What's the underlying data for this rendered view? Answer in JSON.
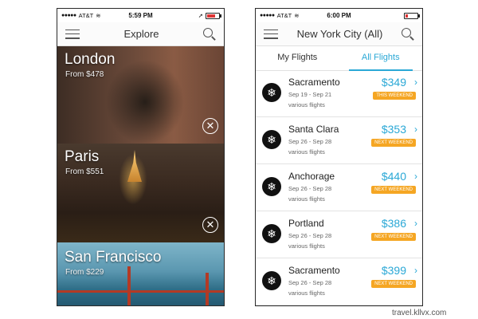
{
  "left_phone": {
    "status": {
      "carrier": "AT&T",
      "time": "5:59 PM"
    },
    "nav": {
      "title": "Explore"
    },
    "destinations": [
      {
        "name": "London",
        "price": "From $478"
      },
      {
        "name": "Paris",
        "price": "From $551"
      },
      {
        "name": "San Francisco",
        "price": "From $229"
      }
    ]
  },
  "right_phone": {
    "status": {
      "carrier": "AT&T",
      "time": "6:00 PM"
    },
    "nav": {
      "title": "New York City (All)"
    },
    "tabs": [
      {
        "label": "My Flights",
        "active": false
      },
      {
        "label": "All Flights",
        "active": true
      }
    ],
    "flights": [
      {
        "city": "Sacramento",
        "dates": "Sep 19 - Sep 21",
        "note": "various flights",
        "price": "$349",
        "tag": "THIS WEEKEND"
      },
      {
        "city": "Santa Clara",
        "dates": "Sep 26 - Sep 28",
        "note": "various flights",
        "price": "$353",
        "tag": "NEXT WEEKEND"
      },
      {
        "city": "Anchorage",
        "dates": "Sep 26 - Sep 28",
        "note": "various flights",
        "price": "$440",
        "tag": "NEXT WEEKEND"
      },
      {
        "city": "Portland",
        "dates": "Sep 26 - Sep 28",
        "note": "various flights",
        "price": "$386",
        "tag": "NEXT WEEKEND"
      },
      {
        "city": "Sacramento",
        "dates": "Sep 26 - Sep 28",
        "note": "various flights",
        "price": "$399",
        "tag": "NEXT WEEKEND"
      }
    ]
  },
  "watermark": "travel.kllvx.com",
  "colors": {
    "accent": "#2aa8d6",
    "tag": "#f5a623"
  },
  "icons": [
    "hamburger-menu-icon",
    "search-icon",
    "compass-icon",
    "snowflake-icon",
    "chevron-right-icon",
    "wifi-icon",
    "battery-icon",
    "location-arrow-icon"
  ]
}
